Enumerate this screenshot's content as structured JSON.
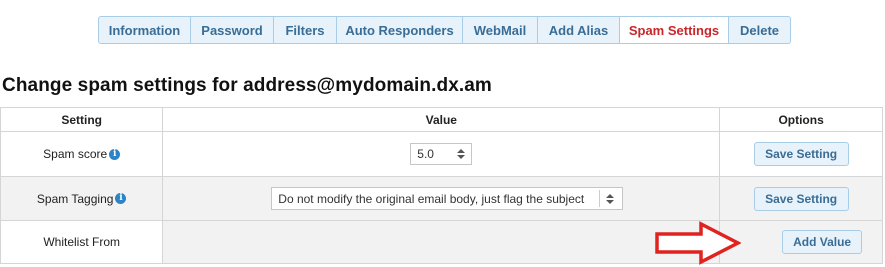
{
  "tabs": [
    {
      "label": "Information",
      "active": false
    },
    {
      "label": "Password",
      "active": false
    },
    {
      "label": "Filters",
      "active": false
    },
    {
      "label": "Auto Responders",
      "active": false
    },
    {
      "label": "WebMail",
      "active": false
    },
    {
      "label": "Add Alias",
      "active": false
    },
    {
      "label": "Spam Settings",
      "active": true
    },
    {
      "label": "Delete",
      "active": false
    }
  ],
  "page_title": "Change spam settings for address@mydomain.dx.am",
  "table": {
    "headers": [
      "Setting",
      "Value",
      "Options"
    ],
    "rows": [
      {
        "setting": "Spam score",
        "value": "5.0",
        "action": "Save Setting"
      },
      {
        "setting": "Spam Tagging",
        "value": "Do not modify the original email body, just flag the subject",
        "action": "Save Setting"
      },
      {
        "setting": "Whitelist From",
        "value": "",
        "action": "Add Value"
      }
    ]
  },
  "colors": {
    "accent": "#3a6d96",
    "active_tab": "#c8262b",
    "button_bg": "#e7f2fa",
    "annotation_arrow": "#e0231e"
  },
  "icons": {
    "info": "info-icon",
    "annotation": "red-arrow-icon"
  }
}
